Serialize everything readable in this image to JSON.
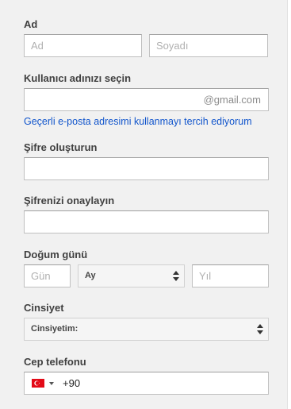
{
  "name": {
    "label": "Ad",
    "first_placeholder": "Ad",
    "last_placeholder": "Soyadı"
  },
  "username": {
    "label": "Kullanıcı adınızı seçin",
    "suffix": "@gmail.com",
    "link": "Geçerli e-posta adresimi kullanmayı tercih ediyorum"
  },
  "password": {
    "label": "Şifre oluşturun"
  },
  "confirm": {
    "label": "Şifrenizi onaylayın"
  },
  "birthday": {
    "label": "Doğum günü",
    "day_placeholder": "Gün",
    "month_value": "Ay",
    "year_placeholder": "Yıl"
  },
  "gender": {
    "label": "Cinsiyet",
    "value": "Cinsiyetim:"
  },
  "phone": {
    "label": "Cep telefonu",
    "country_code": "+90",
    "flag_icon": "turkey-flag-icon"
  },
  "colors": {
    "background": "#f1f1f1",
    "link": "#1155cc",
    "flag_red": "#e30a17"
  }
}
